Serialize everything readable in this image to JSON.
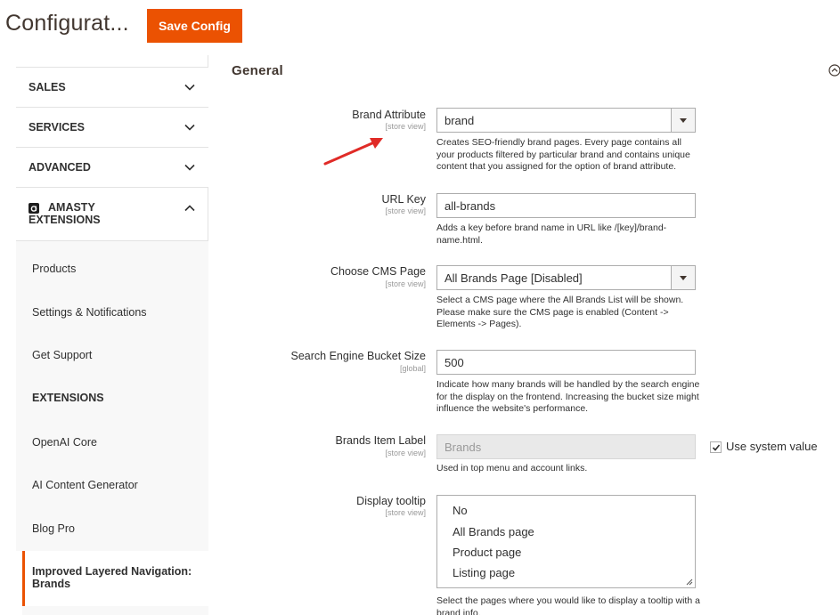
{
  "header": {
    "title": "Configurat...",
    "save_label": "Save Config"
  },
  "sidebar": {
    "sections": [
      {
        "label": "SALES"
      },
      {
        "label": "SERVICES"
      },
      {
        "label": "ADVANCED"
      }
    ],
    "amasty": {
      "line1": "AMASTY",
      "line2": "EXTENSIONS"
    },
    "sub_items": [
      "Products",
      "Settings & Notifications",
      "Get Support"
    ],
    "extensions_heading": "EXTENSIONS",
    "ext_items": [
      "OpenAI Core",
      "AI Content Generator",
      "Blog Pro"
    ],
    "active_item": "Improved Layered Navigation: Brands"
  },
  "main": {
    "section_title": "General",
    "fields": {
      "brand_attribute": {
        "label": "Brand Attribute",
        "scope": "[store view]",
        "value": "brand",
        "note": "Creates SEO-friendly brand pages. Every page contains all your products filtered by particular brand and contains unique content that you assigned for the option of brand attribute."
      },
      "url_key": {
        "label": "URL Key",
        "scope": "[store view]",
        "value": "all-brands",
        "note": "Adds a key before brand name in URL like /[key]/brand-name.html."
      },
      "cms_page": {
        "label": "Choose CMS Page",
        "scope": "[store view]",
        "value": "All Brands Page [Disabled]",
        "note": "Select a CMS page where the All Brands List will be shown. Please make sure the CMS page is enabled (Content -> Elements -> Pages)."
      },
      "bucket_size": {
        "label": "Search Engine Bucket Size",
        "scope": "[global]",
        "value": "500",
        "note": "Indicate how many brands will be handled by the search engine for the display on the frontend. Increasing the bucket size might influence the website's performance."
      },
      "item_label": {
        "label": "Brands Item Label",
        "scope": "[store view]",
        "value": "Brands",
        "use_system": "Use system value",
        "note": "Used in top menu and account links."
      },
      "tooltip": {
        "label": "Display tooltip",
        "scope": "[store view]",
        "options": [
          "No",
          "All Brands page",
          "Product page",
          "Listing page"
        ],
        "note": "Select the pages where you would like to display a tooltip with a brand info."
      }
    }
  },
  "colors": {
    "accent": "#eb5202",
    "annotation_arrow": "#e02b27"
  }
}
